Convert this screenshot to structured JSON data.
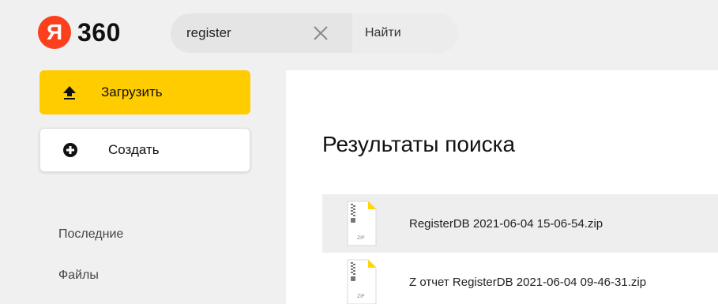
{
  "header": {
    "logo_letter": "Я",
    "logo_text": "360",
    "search": {
      "value": "register",
      "placeholder": ""
    },
    "search_button_label": "Найти"
  },
  "sidebar": {
    "upload_label": "Загрузить",
    "create_label": "Создать",
    "nav": [
      {
        "label": "Последние"
      },
      {
        "label": "Файлы"
      }
    ]
  },
  "main": {
    "title": "Результаты поиска",
    "files": [
      {
        "name": "RegisterDB 2021-06-04 15-06-54.zip",
        "type_label": "ZIP",
        "selected": true
      },
      {
        "name": "Z отчет RegisterDB 2021-06-04 09-46-31.zip",
        "type_label": "ZIP",
        "selected": false
      }
    ]
  },
  "colors": {
    "brand_red": "#fc3f1d",
    "upload_yellow": "#ffcc00",
    "page_bg": "#f0f0f0",
    "zip_flag": "#ffd600"
  }
}
